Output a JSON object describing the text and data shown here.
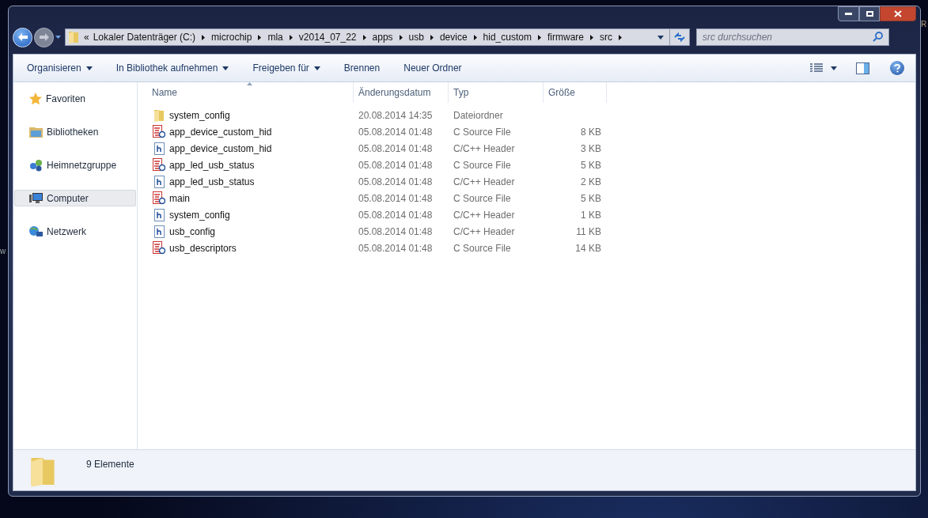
{
  "desktop_fragments": [
    "R",
    "w"
  ],
  "address_bar": {
    "overflow": "«",
    "segments": [
      "Lokaler Datenträger (C:)",
      "microchip",
      "mla",
      "v2014_07_22",
      "apps",
      "usb",
      "device",
      "hid_custom",
      "firmware",
      "src"
    ]
  },
  "search": {
    "placeholder": "src durchsuchen"
  },
  "toolbar": [
    {
      "label": "Organisieren",
      "dropdown": true
    },
    {
      "label": "In Bibliothek aufnehmen",
      "dropdown": true
    },
    {
      "label": "Freigeben für",
      "dropdown": true
    },
    {
      "label": "Brennen",
      "dropdown": false
    },
    {
      "label": "Neuer Ordner",
      "dropdown": false
    }
  ],
  "sidebar": {
    "items": [
      {
        "label": "Favoriten",
        "kind": "star",
        "selected": false
      },
      {
        "label": "Bibliotheken",
        "kind": "library",
        "selected": false
      },
      {
        "label": "Heimnetzgruppe",
        "kind": "homegroup",
        "selected": false
      },
      {
        "label": "Computer",
        "kind": "computer",
        "selected": true
      },
      {
        "label": "Netzwerk",
        "kind": "network",
        "selected": false
      }
    ]
  },
  "table": {
    "columns": [
      "Name",
      "Änderungsdatum",
      "Typ",
      "Größe"
    ],
    "rows": [
      {
        "kind": "folder",
        "name": "system_config",
        "date": "20.08.2014 14:35",
        "type": "Dateiordner",
        "size": ""
      },
      {
        "kind": "c-source",
        "name": "app_device_custom_hid",
        "date": "05.08.2014 01:48",
        "type": "C Source File",
        "size": "8 KB"
      },
      {
        "kind": "header",
        "name": "app_device_custom_hid",
        "date": "05.08.2014 01:48",
        "type": "C/C++ Header",
        "size": "3 KB"
      },
      {
        "kind": "c-source",
        "name": "app_led_usb_status",
        "date": "05.08.2014 01:48",
        "type": "C Source File",
        "size": "5 KB"
      },
      {
        "kind": "header",
        "name": "app_led_usb_status",
        "date": "05.08.2014 01:48",
        "type": "C/C++ Header",
        "size": "2 KB"
      },
      {
        "kind": "c-source",
        "name": "main",
        "date": "05.08.2014 01:48",
        "type": "C Source File",
        "size": "5 KB"
      },
      {
        "kind": "header",
        "name": "system_config",
        "date": "05.08.2014 01:48",
        "type": "C/C++ Header",
        "size": "1 KB"
      },
      {
        "kind": "header",
        "name": "usb_config",
        "date": "05.08.2014 01:48",
        "type": "C/C++ Header",
        "size": "11 KB"
      },
      {
        "kind": "c-source",
        "name": "usb_descriptors",
        "date": "05.08.2014 01:48",
        "type": "C Source File",
        "size": "14 KB"
      }
    ]
  },
  "status_bar": {
    "count": "9 Elemente"
  }
}
